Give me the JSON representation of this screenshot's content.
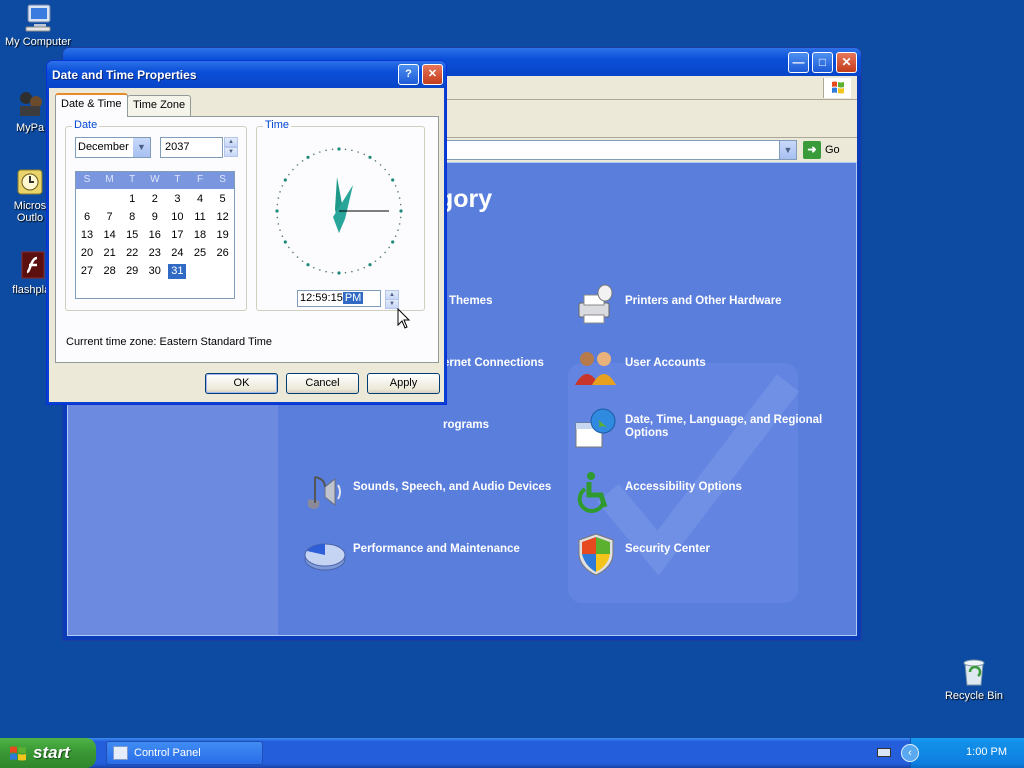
{
  "desktop": {
    "icons": [
      {
        "label": "My Computer"
      },
      {
        "label": "MyPa"
      },
      {
        "label": "Micros Outlo"
      },
      {
        "label": "flashplay"
      },
      {
        "label": "Recycle Bin"
      }
    ]
  },
  "control_panel": {
    "heading": "gory",
    "go_label": "Go",
    "categories": [
      {
        "label": "Themes",
        "icon": "appearance-icon"
      },
      {
        "label": "Printers and Other Hardware",
        "icon": "printer-icon"
      },
      {
        "label": "ernet Connections",
        "icon": "network-icon"
      },
      {
        "label": "User Accounts",
        "icon": "users-icon"
      },
      {
        "label": "rograms",
        "icon": "programs-icon"
      },
      {
        "label": "Date, Time, Language, and Regional Options",
        "icon": "calendar-globe-icon"
      },
      {
        "label": "Sounds, Speech, and Audio Devices",
        "icon": "speaker-icon"
      },
      {
        "label": "Accessibility Options",
        "icon": "accessibility-icon"
      },
      {
        "label": "Performance and Maintenance",
        "icon": "pie-chart-icon"
      },
      {
        "label": "Security Center",
        "icon": "shield-icon"
      }
    ]
  },
  "dialog": {
    "title": "Date and Time Properties",
    "help_label": "?",
    "close_label": "✕",
    "tabs": [
      {
        "label": "Date & Time",
        "active": true
      },
      {
        "label": "Time Zone",
        "active": false
      }
    ],
    "date_group_label": "Date",
    "time_group_label": "Time",
    "month_value": "December",
    "year_value": "2037",
    "day_headers": [
      "S",
      "M",
      "T",
      "W",
      "T",
      "F",
      "S"
    ],
    "weeks": [
      [
        "",
        "",
        "1",
        "2",
        "3",
        "4",
        "5"
      ],
      [
        "6",
        "7",
        "8",
        "9",
        "10",
        "11",
        "12"
      ],
      [
        "13",
        "14",
        "15",
        "16",
        "17",
        "18",
        "19"
      ],
      [
        "20",
        "21",
        "22",
        "23",
        "24",
        "25",
        "26"
      ],
      [
        "27",
        "28",
        "29",
        "30",
        "31",
        "",
        ""
      ]
    ],
    "selected_day": "31",
    "time_main": "12:59:15",
    "time_ampm": "PM",
    "timezone_text": "Current time zone:  Eastern Standard Time",
    "buttons": {
      "ok": "OK",
      "cancel": "Cancel",
      "apply": "Apply"
    }
  },
  "taskbar": {
    "start_label": "start",
    "task_label": "Control Panel",
    "clock": "1:00 PM"
  },
  "colors": {
    "desktop": "#0c4ba1",
    "titlebar": "#0a4fd8",
    "dialog_bg": "#ece9d8",
    "selection": "#316ac5",
    "cp_content": "#5a7edc"
  }
}
